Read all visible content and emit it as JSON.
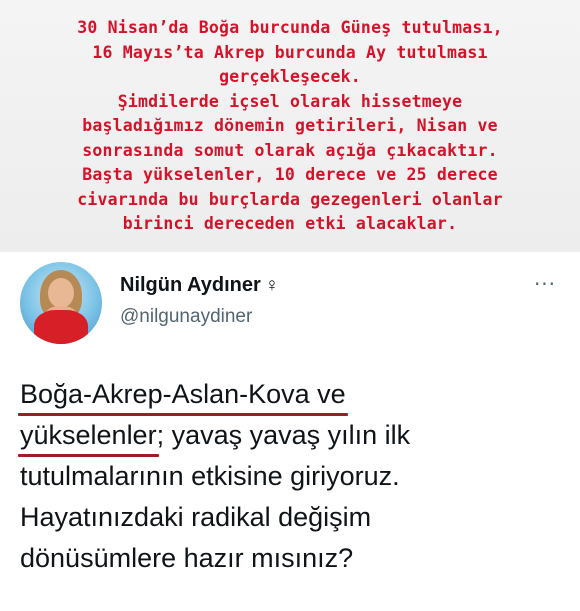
{
  "caption": {
    "lines": [
      "30 Nisan’da Boğa burcunda Güneş tutulması,",
      "16 Mayıs’ta Akrep burcunda Ay tutulması",
      "gerçekleşecek.",
      "Şimdilerde içsel olarak hissetmeye",
      "başladığımız dönemin getirileri, Nisan ve",
      "sonrasında somut olarak açığa çıkacaktır.",
      "Başta yükselenler, 10 derece ve 25 derece",
      "civarında bu burçlarda gezegenleri olanlar",
      "birinci dereceden etki alacaklar."
    ],
    "color": "#d4132a"
  },
  "tweet": {
    "user": {
      "name": "Nilgün Aydıner",
      "gender_symbol": "♀",
      "handle": "@nilgunaydiner"
    },
    "more_symbol": "···",
    "text": {
      "line1": "Boğa-Akrep-Aslan-Kova ve",
      "line2_highlight": "yükselenler",
      "line2_rest": "; yavaş yavaş yılın ilk",
      "line3": "tutulmalarının etkisine giriyoruz.",
      "line4": "Hayatınızdaki radikal değişim",
      "line5": "dönüsümlere hazır mısınız?"
    },
    "underline_color": "#9e1c22"
  }
}
